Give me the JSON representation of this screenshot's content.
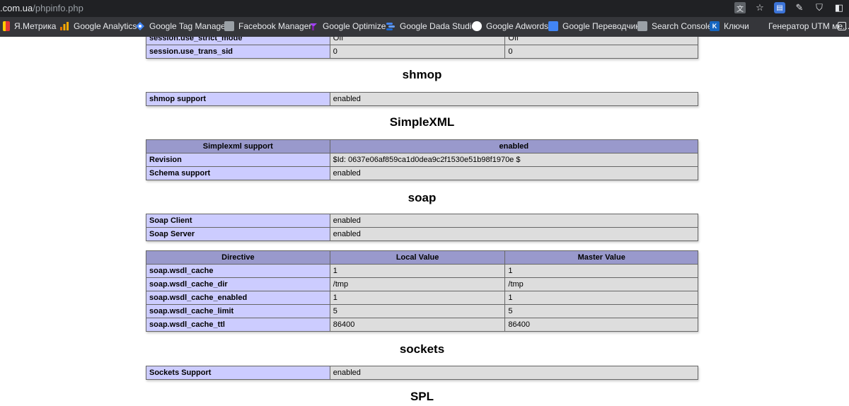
{
  "browser": {
    "url_host": ".com.ua",
    "url_path": "/phpinfo.php",
    "icons": [
      "translate-icon",
      "star-icon",
      "extension-icon",
      "extension-icon",
      "shield-icon",
      "extension-icon"
    ],
    "bookmarks": [
      {
        "label": "Я.Метрика",
        "icon": "yandex-metrika-icon",
        "color": "#e53935"
      },
      {
        "label": "Google Analytics",
        "icon": "analytics-icon",
        "color": "#f9ab00"
      },
      {
        "label": "Google Tag Manager",
        "icon": "tag-manager-icon",
        "color": "#4285f4"
      },
      {
        "label": "Facebook Manager",
        "icon": "facebook-manager-icon",
        "color": "#9aa0a6"
      },
      {
        "label": "Google Optimize",
        "icon": "optimize-icon",
        "color": "#a142f4"
      },
      {
        "label": "Google Dada Studio",
        "icon": "data-studio-icon",
        "color": "#4285f4"
      },
      {
        "label": "Google Adwords",
        "icon": "adwords-icon",
        "color": "#ffffff"
      },
      {
        "label": "Google Переводчик",
        "icon": "translate-icon",
        "color": "#4285f4"
      },
      {
        "label": "Search Console",
        "icon": "search-console-icon",
        "color": "#9aa0a6"
      },
      {
        "label": "Ключи",
        "icon": "keys-icon",
        "color": "#1565c0"
      },
      {
        "label": "Генератор UTM ме...",
        "icon": "utm-generator-icon",
        "color": "#35363a"
      }
    ]
  },
  "session_tail": [
    {
      "key": "session.use_strict_mode",
      "local": "Off",
      "master": "Off"
    },
    {
      "key": "session.use_trans_sid",
      "local": "0",
      "master": "0"
    }
  ],
  "sections": {
    "shmop": {
      "title": "shmop",
      "rows": [
        {
          "key": "shmop support",
          "value": "enabled"
        }
      ]
    },
    "simplexml": {
      "title": "SimpleXML",
      "header": [
        "Simplexml support",
        "enabled"
      ],
      "rows": [
        {
          "key": "Revision",
          "value": "$Id: 0637e06af859ca1d0dea9c2f1530e51b98f1970e $"
        },
        {
          "key": "Schema support",
          "value": "enabled"
        }
      ]
    },
    "soap": {
      "title": "soap",
      "rows": [
        {
          "key": "Soap Client",
          "value": "enabled"
        },
        {
          "key": "Soap Server",
          "value": "enabled"
        }
      ],
      "directive_headers": [
        "Directive",
        "Local Value",
        "Master Value"
      ],
      "directives": [
        {
          "key": "soap.wsdl_cache",
          "local": "1",
          "master": "1"
        },
        {
          "key": "soap.wsdl_cache_dir",
          "local": "/tmp",
          "master": "/tmp"
        },
        {
          "key": "soap.wsdl_cache_enabled",
          "local": "1",
          "master": "1"
        },
        {
          "key": "soap.wsdl_cache_limit",
          "local": "5",
          "master": "5"
        },
        {
          "key": "soap.wsdl_cache_ttl",
          "local": "86400",
          "master": "86400"
        }
      ]
    },
    "sockets": {
      "title": "sockets",
      "rows": [
        {
          "key": "Sockets Support",
          "value": "enabled"
        }
      ]
    },
    "spl": {
      "title": "SPL"
    }
  }
}
